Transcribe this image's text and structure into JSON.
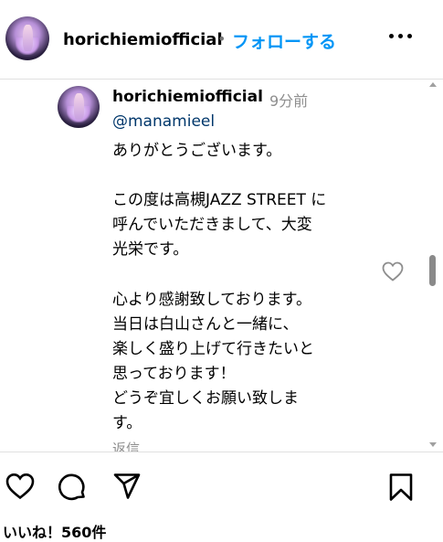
{
  "header": {
    "username": "horichiemiofficial",
    "separator": "•",
    "follow_label": "フォローする"
  },
  "comment": {
    "username": "horichiemiofficial",
    "time": "9分前",
    "mention": "@manamieel",
    "lines": [
      "ありがとうございます。",
      "",
      "この度は高槻JAZZ STREET に",
      "呼んでいただきまして、大変",
      "光栄です。",
      "",
      "心より感謝致しております。",
      "当日は白山さんと一緒に、",
      "楽しく盛り上げて行きたいと",
      "思っております！",
      "どうぞ宜しくお願い致しま",
      "す。"
    ],
    "reply_label": "返信"
  },
  "actions": {
    "likes_text": "いいね！560件"
  },
  "icons": {
    "more": "more-options-icon",
    "like": "heart-icon",
    "comment": "comment-icon",
    "share": "share-icon",
    "save": "bookmark-icon"
  }
}
